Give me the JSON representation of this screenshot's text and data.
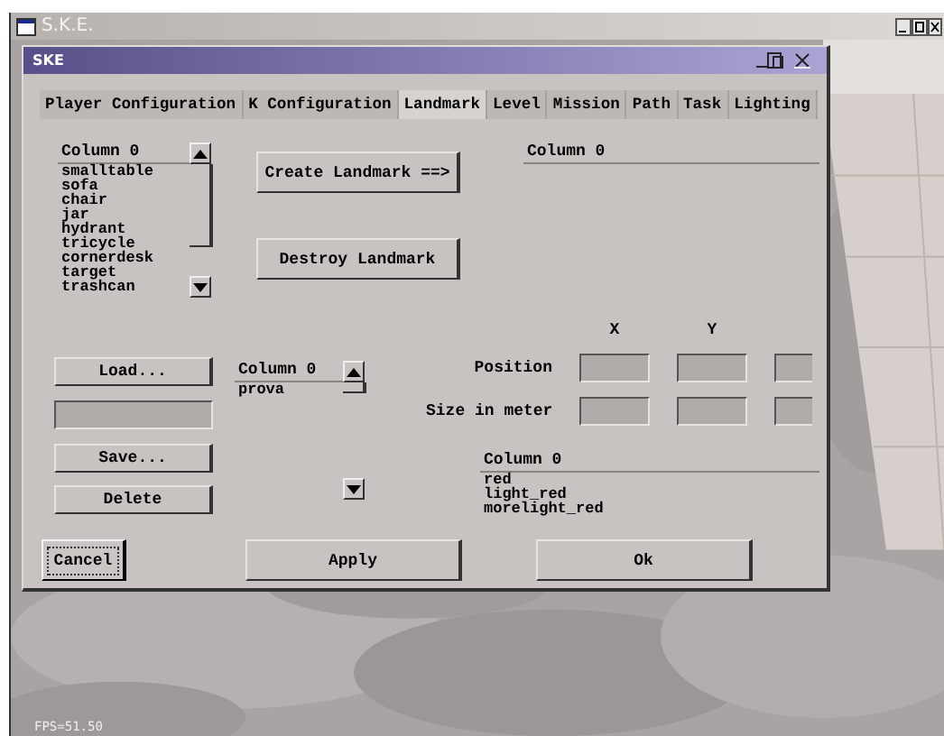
{
  "outer_window": {
    "title": "S.K.E."
  },
  "dialog": {
    "title": "SKE"
  },
  "tabs": [
    {
      "label": "Player Configuration",
      "selected": false
    },
    {
      "label": "K Configuration",
      "selected": false
    },
    {
      "label": "Landmark",
      "selected": true
    },
    {
      "label": "Level",
      "selected": false
    },
    {
      "label": "Mission",
      "selected": false
    },
    {
      "label": "Path",
      "selected": false
    },
    {
      "label": "Task",
      "selected": false
    },
    {
      "label": "Lighting",
      "selected": false
    }
  ],
  "landmark_types": {
    "header": "Column 0",
    "items": [
      "smalltable",
      "sofa",
      "chair",
      "jar",
      "hydrant",
      "tricycle",
      "cornerdesk",
      "target",
      "trashcan"
    ]
  },
  "landmark_actions": [
    "Create Landmark ==>",
    "Destroy Landmark"
  ],
  "landmarks": {
    "header": "Column 0"
  },
  "file_buttons": {
    "load": "Load...",
    "save": "Save...",
    "delete": "Delete"
  },
  "files": {
    "header": "Column 0",
    "items": [
      "prova"
    ]
  },
  "coordinates": {
    "axes": [
      "X",
      "Y"
    ],
    "rows": [
      {
        "label": "Position"
      },
      {
        "label": "Size in meter"
      }
    ]
  },
  "colors": {
    "header": "Column 0",
    "items": [
      "red",
      "light_red",
      "morelight_red"
    ]
  },
  "footer_buttons": [
    {
      "label": "Cancel",
      "focused": true
    },
    {
      "label": "Apply",
      "focused": false
    },
    {
      "label": "Ok",
      "focused": false
    }
  ],
  "overlay_text": "FPS=51.50"
}
